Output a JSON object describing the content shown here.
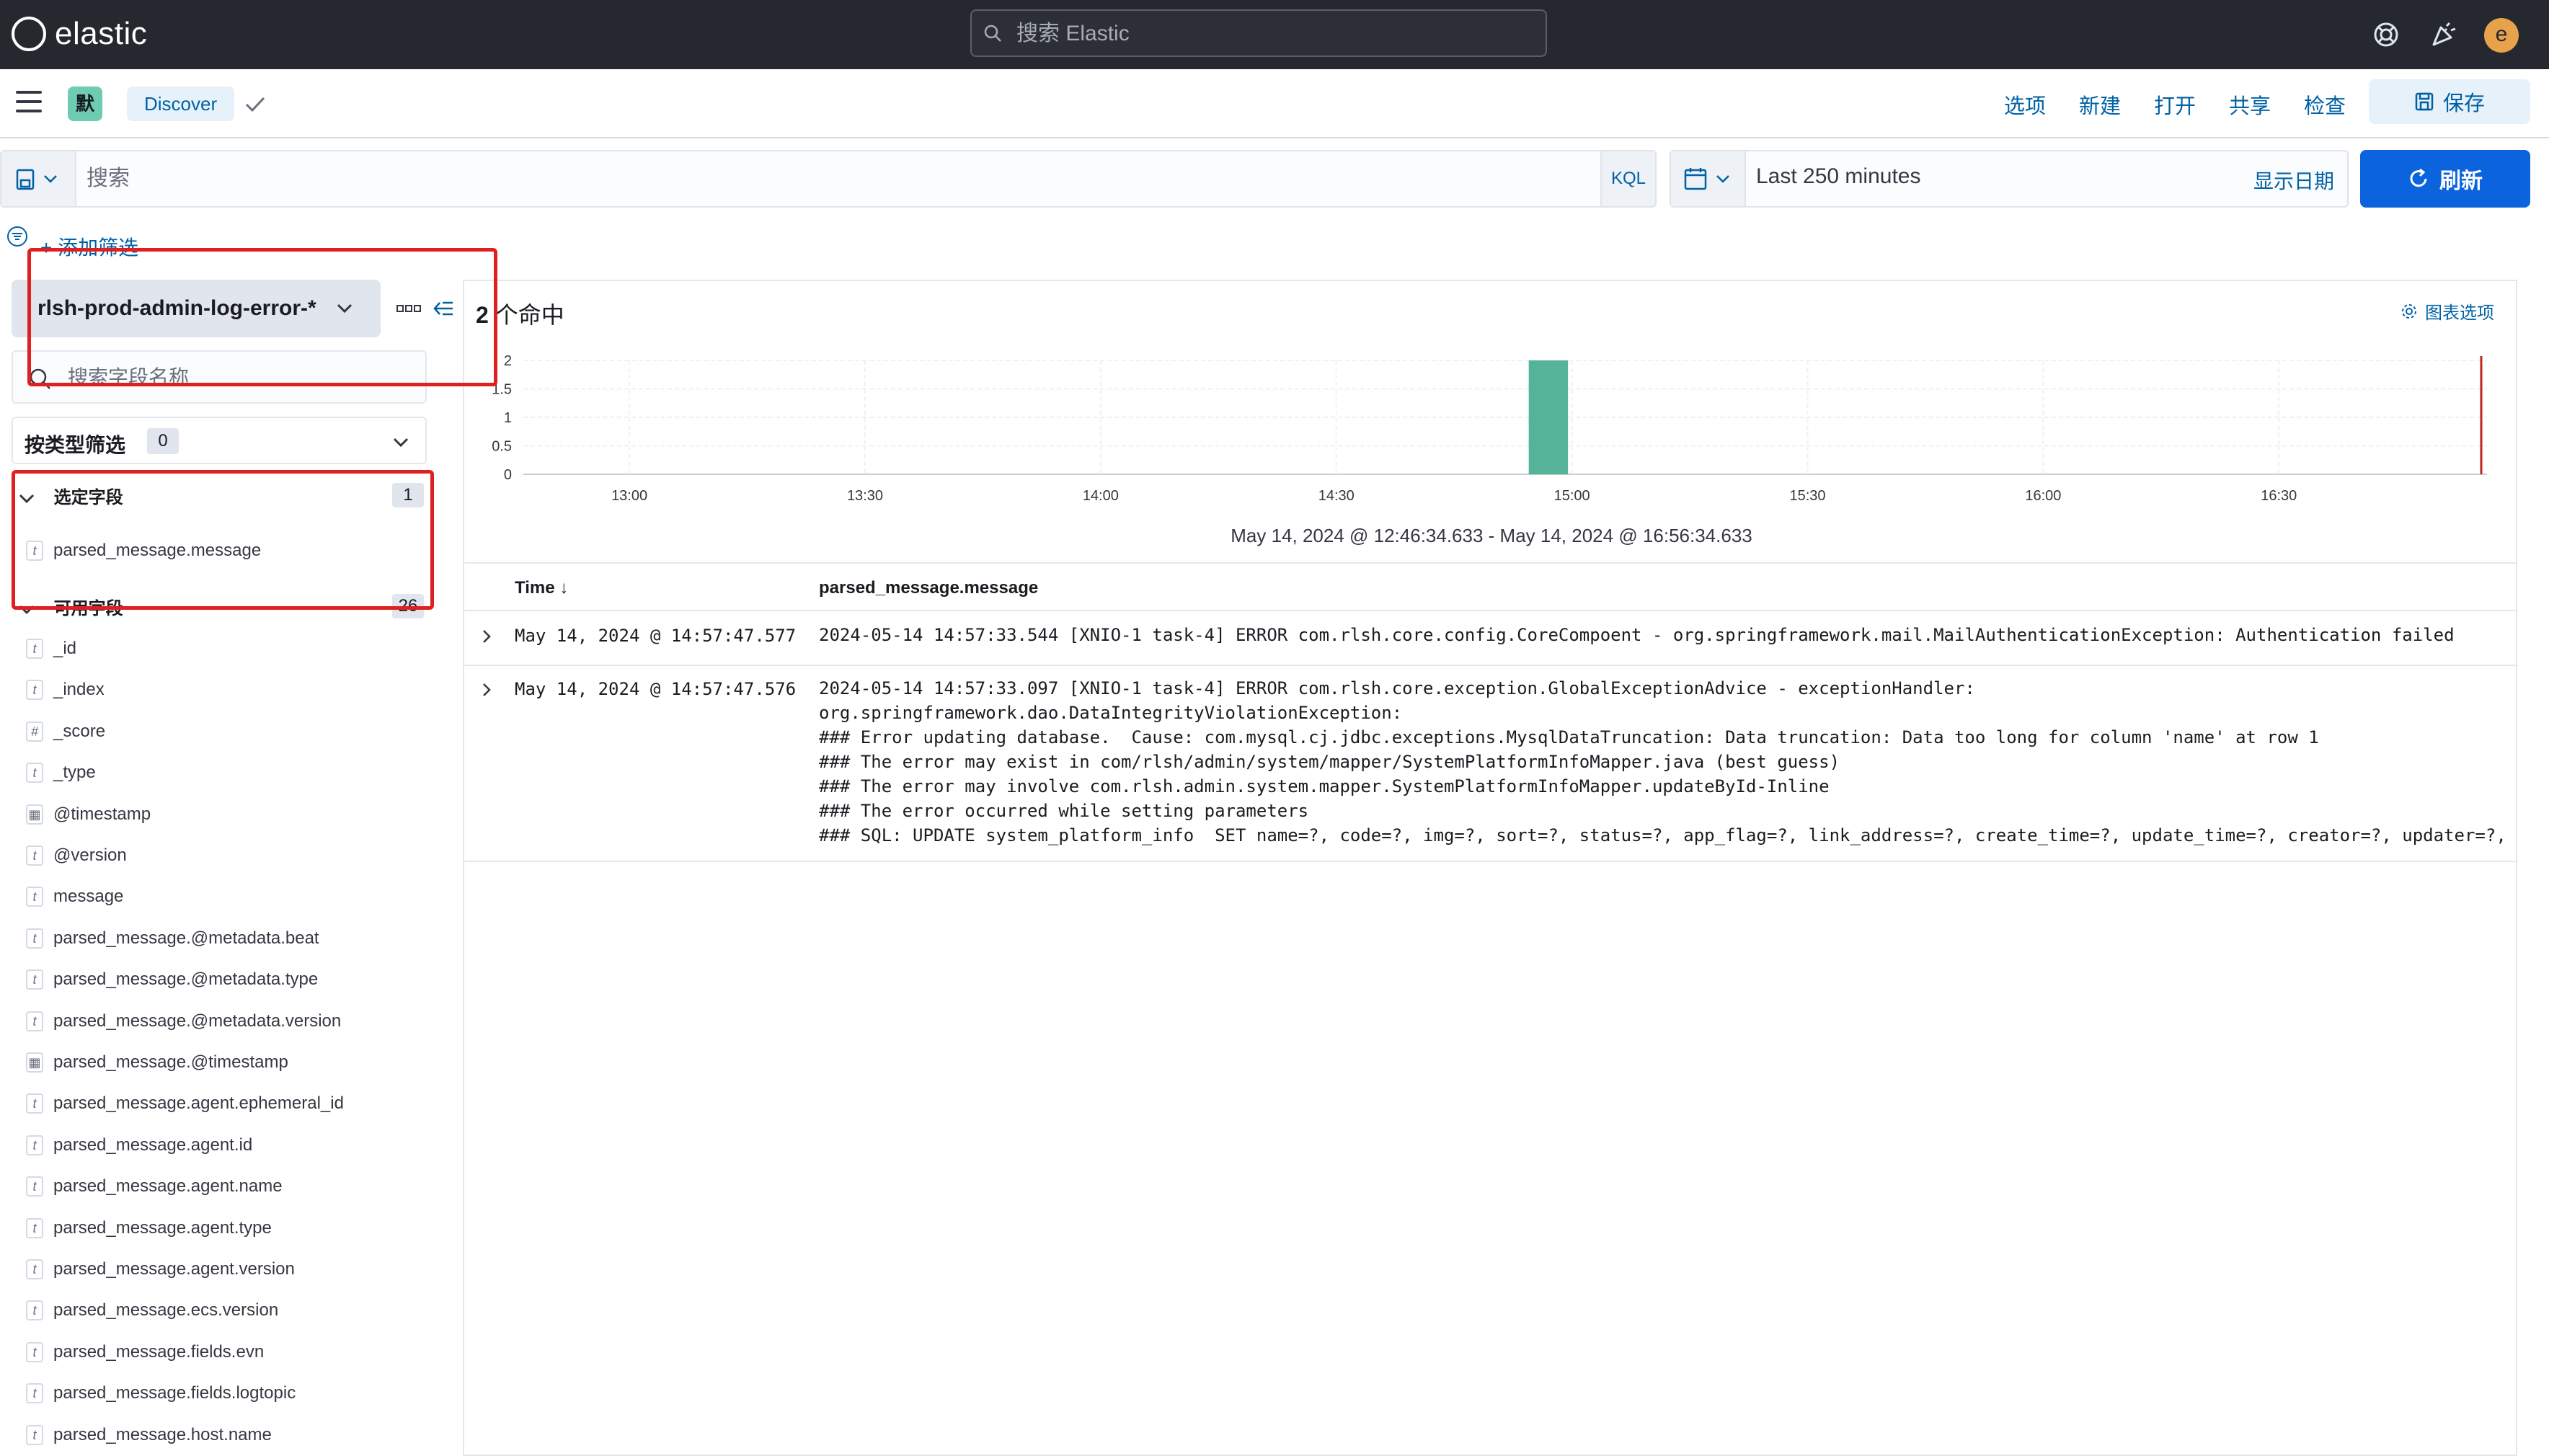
{
  "header": {
    "logo_text": "elastic",
    "search_placeholder": "搜索 Elastic",
    "avatar_letter": "e"
  },
  "subheader": {
    "space_badge": "默",
    "breadcrumb": "Discover",
    "menu": {
      "options": "选项",
      "new": "新建",
      "open": "打开",
      "share": "共享",
      "inspect": "检查",
      "save": "保存"
    }
  },
  "query": {
    "placeholder": "搜索",
    "language": "KQL",
    "time_range": "Last 250 minutes",
    "show_dates": "显示日期",
    "refresh": "刷新",
    "add_filter": "+ 添加筛选"
  },
  "sidebar": {
    "index_pattern": "rlsh-prod-admin-log-error-*",
    "field_search_placeholder": "搜索字段名称",
    "type_filter_label": "按类型筛选",
    "type_filter_count": "0",
    "selected_label": "选定字段",
    "selected_count": "1",
    "selected_fields": [
      {
        "type": "t",
        "name": "parsed_message.message"
      }
    ],
    "available_label": "可用字段",
    "available_count": "26",
    "available_fields": [
      {
        "type": "t",
        "name": "_id"
      },
      {
        "type": "t",
        "name": "_index"
      },
      {
        "type": "#",
        "name": "_score"
      },
      {
        "type": "t",
        "name": "_type"
      },
      {
        "type": "date",
        "name": "@timestamp"
      },
      {
        "type": "t",
        "name": "@version"
      },
      {
        "type": "t",
        "name": "message"
      },
      {
        "type": "t",
        "name": "parsed_message.@metadata.beat"
      },
      {
        "type": "t",
        "name": "parsed_message.@metadata.type"
      },
      {
        "type": "t",
        "name": "parsed_message.@metadata.version"
      },
      {
        "type": "date",
        "name": "parsed_message.@timestamp"
      },
      {
        "type": "t",
        "name": "parsed_message.agent.ephemeral_id"
      },
      {
        "type": "t",
        "name": "parsed_message.agent.id"
      },
      {
        "type": "t",
        "name": "parsed_message.agent.name"
      },
      {
        "type": "t",
        "name": "parsed_message.agent.type"
      },
      {
        "type": "t",
        "name": "parsed_message.agent.version"
      },
      {
        "type": "t",
        "name": "parsed_message.ecs.version"
      },
      {
        "type": "t",
        "name": "parsed_message.fields.evn"
      },
      {
        "type": "t",
        "name": "parsed_message.fields.logtopic"
      },
      {
        "type": "t",
        "name": "parsed_message.host.name"
      }
    ]
  },
  "main": {
    "hits_count": "2",
    "hits_label": "个命中",
    "chart_options": "图表选项",
    "time_range_text": "May 14, 2024 @ 12:46:34.633 - May 14, 2024 @ 16:56:34.633",
    "columns": {
      "time": "Time ↓",
      "message": "parsed_message.message"
    },
    "rows": [
      {
        "time": "May 14, 2024 @ 14:57:47.577",
        "message": "2024-05-14 14:57:33.544 [XNIO-1 task-4] ERROR com.rlsh.core.config.CoreCompoent - org.springframework.mail.MailAuthenticationException: Authentication failed"
      },
      {
        "time": "May 14, 2024 @ 14:57:47.576",
        "message": "2024-05-14 14:57:33.097 [XNIO-1 task-4] ERROR com.rlsh.core.exception.GlobalExceptionAdvice - exceptionHandler:\norg.springframework.dao.DataIntegrityViolationException:\n### Error updating database.  Cause: com.mysql.cj.jdbc.exceptions.MysqlDataTruncation: Data truncation: Data too long for column 'name' at row 1\n### The error may exist in com/rlsh/admin/system/mapper/SystemPlatformInfoMapper.java (best guess)\n### The error may involve com.rlsh.admin.system.mapper.SystemPlatformInfoMapper.updateById-Inline\n### The error occurred while setting parameters\n### SQL: UPDATE system_platform_info  SET name=?, code=?, img=?, sort=?, status=?, app_flag=?, link_address=?, create_time=?, update_time=?, creator=?, updater=?,"
      }
    ]
  },
  "chart_data": {
    "type": "bar",
    "x_ticks": [
      "13:00",
      "13:30",
      "14:00",
      "14:30",
      "15:00",
      "15:30",
      "16:00",
      "16:30"
    ],
    "y_ticks": [
      "0",
      "0.5",
      "1",
      "1.5",
      "2"
    ],
    "ylim": [
      0,
      2
    ],
    "bars": [
      {
        "x": "14:57",
        "value": 2
      }
    ],
    "bar_color": "#54b399",
    "now_marker_color": "#bd271e",
    "grid": true
  },
  "colors": {
    "header_bg": "#25282f",
    "link": "#0061a6",
    "primary": "#0b64dd",
    "annotation": "#e02020"
  }
}
